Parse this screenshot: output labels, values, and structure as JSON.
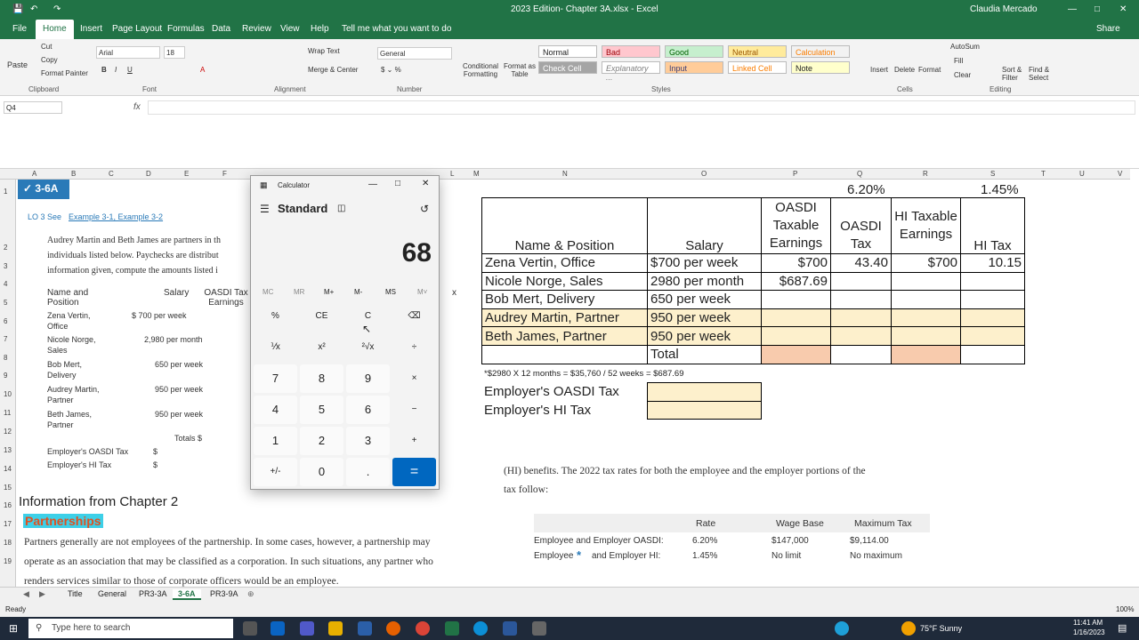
{
  "titlebar": {
    "title": "2023 Edition- Chapter 3A.xlsx - Excel",
    "user": "Claudia Mercado"
  },
  "menu": [
    "File",
    "Home",
    "Insert",
    "Page Layout",
    "Formulas",
    "Data",
    "Review",
    "View",
    "Help",
    "Tell me what you want to do"
  ],
  "share": "Share",
  "ribbon": {
    "cut": "Cut",
    "copy": "Copy",
    "format_painter": "Format Painter",
    "paste": "Paste",
    "font_name": "Arial",
    "font_size": "18",
    "wrap_text": "Wrap Text",
    "merge_center": "Merge & Center",
    "number_format": "General",
    "conditional": "Conditional Formatting",
    "format_table": "Format as Table",
    "styles": [
      "Normal",
      "Bad",
      "Good",
      "Neutral",
      "Calculation",
      "Check Cell",
      "Explanatory ...",
      "Input",
      "Linked Cell",
      "Note"
    ],
    "cells": [
      "Insert",
      "Delete",
      "Format"
    ],
    "autosum": "AutoSum",
    "fill": "Fill",
    "clear": "Clear",
    "sort": "Sort & Filter",
    "find": "Find & Select",
    "groups": [
      "Clipboard",
      "Font",
      "Alignment",
      "Number",
      "Styles",
      "Cells",
      "Editing"
    ]
  },
  "namebox": "Q4",
  "columns": [
    "A",
    "B",
    "C",
    "D",
    "E",
    "F",
    "G",
    "H",
    "I",
    "J",
    "K",
    "L",
    "M",
    "N",
    "O",
    "P",
    "Q",
    "R",
    "S",
    "T",
    "U",
    "V"
  ],
  "rows": [
    "1",
    "2",
    "3",
    "4",
    "5",
    "6",
    "7",
    "8",
    "9",
    "10",
    "11",
    "12",
    "13",
    "14",
    "15",
    "16",
    "17",
    "18",
    "19"
  ],
  "left_image": {
    "badge": "3-6A",
    "lo": "LO 3  See",
    "links": "Example 3-1, Example 3-2",
    "para": [
      "Audrey Martin and Beth James are partners in th",
      "individuals listed below. Paychecks are distribut",
      "information given, compute the amounts listed i"
    ],
    "hdr_name": "Name and Position",
    "hdr_salary": "Salary",
    "hdr_oasdi": "OASDI Tax Earnings",
    "hdr_x": "x",
    "people": [
      {
        "name": "Zena Vertin,",
        "pos": "Office",
        "salary": "$    700 per week"
      },
      {
        "name": "Nicole Norge,",
        "pos": "Sales",
        "salary": "2,980 per month"
      },
      {
        "name": "Bob Mert,",
        "pos": "Delivery",
        "salary": "650 per week"
      },
      {
        "name": "Audrey Martin,",
        "pos": "Partner",
        "salary": "950 per week"
      },
      {
        "name": "Beth James,",
        "pos": "Partner",
        "salary": "950 per week"
      }
    ],
    "totals": "Totals $",
    "emp_oasdi": "Employer's OASDI Tax",
    "emp_hi": "Employer's HI Tax",
    "dollar": "$"
  },
  "calculator": {
    "title": "Calculator",
    "mode": "Standard",
    "display": "68",
    "memory": [
      "MC",
      "MR",
      "M+",
      "M-",
      "MS",
      "M˅"
    ],
    "keys": [
      "%",
      "CE",
      "C",
      "⌫",
      "⅟x",
      "x²",
      "²√x",
      "÷",
      "7",
      "8",
      "9",
      "×",
      "4",
      "5",
      "6",
      "−",
      "1",
      "2",
      "3",
      "+",
      "+/-",
      "0",
      ".",
      "="
    ]
  },
  "sheet": {
    "rate_oasdi": "6.20%",
    "rate_hi": "1.45%",
    "headers": [
      "Name & Position",
      "Salary",
      "OASDI Taxable Earnings",
      "OASDI Tax",
      "HI Taxable Earnings",
      "HI Tax"
    ],
    "rows": [
      [
        "Zena Vertin, Office",
        "$700 per week",
        "$700",
        "43.40",
        "$700",
        "10.15"
      ],
      [
        "Nicole Norge, Sales",
        "2980 per month",
        "$687.69",
        "",
        "",
        ""
      ],
      [
        "Bob Mert, Delivery",
        "650 per week",
        "",
        "",
        "",
        ""
      ],
      [
        "Audrey Martin, Partner",
        "950 per week",
        "",
        "",
        "",
        ""
      ],
      [
        "Beth James, Partner",
        "950 per week",
        "",
        "",
        "",
        ""
      ]
    ],
    "total": "Total",
    "note": "*$2980 X 12 months = $35,760 / 52 weeks = $687.69",
    "emp_oasdi": "Employer's OASDI Tax",
    "emp_hi": "Employer's HI Tax"
  },
  "bottom_left": {
    "heading": "Information from Chapter 2",
    "sub": "Partnerships",
    "lines": [
      "Partners generally are not employees of the partnership. In some cases, however, a partnership may",
      "operate as an association that may be classified as a corporation. In such situations, any partner who",
      "renders services similar to those of corporate officers would be an employee."
    ]
  },
  "bottom_right": {
    "lines": [
      "(HI) benefits. The 2022 tax rates for both the employee and the employer portions of the",
      "tax follow:"
    ],
    "thead": [
      "Rate",
      "Wage Base",
      "Maximum Tax"
    ],
    "trows": [
      [
        "Employee and Employer OASDI:",
        "6.20%",
        "$147,000",
        "$9,114.00"
      ],
      [
        "Employee",
        "and Employer HI:",
        "1.45%",
        "No limit",
        "No maximum"
      ]
    ]
  },
  "tabs": [
    "Title",
    "General",
    "PR3-3A",
    "3-6A",
    "PR3-9A"
  ],
  "status": {
    "ready": "Ready",
    "zoom": "100%"
  },
  "taskbar": {
    "search": "Type here to search",
    "weather": "75°F  Sunny",
    "time": "11:41 AM",
    "date": "1/16/2023"
  },
  "colors": {
    "excel_green": "#217346",
    "highlight": "#fdf0cc",
    "orange": "#f8cbad",
    "calc_equals": "#0067c0"
  }
}
